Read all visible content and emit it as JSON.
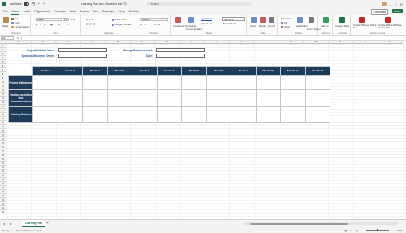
{
  "titlebar": {
    "autosave_label": "AutoSave",
    "doc_title": "Learning Plan.xlsx • Saved to this PC",
    "search_placeholder": "Search",
    "window_controls": [
      "–",
      "□",
      "✕"
    ]
  },
  "tabs": [
    "File",
    "Home",
    "Insert",
    "Page Layout",
    "Formulas",
    "Data",
    "Review",
    "View",
    "Developer",
    "Help",
    "Acrobat"
  ],
  "active_tab": "Home",
  "tab_buttons": {
    "comments": "Comments",
    "share": "Share"
  },
  "ribbon": {
    "clipboard": {
      "paste": "Paste",
      "cut": "Cut",
      "copy": "Copy",
      "format_painter": "Format Painter",
      "label": "Clipboard"
    },
    "font": {
      "font_name": "Calibri",
      "font_size": "11",
      "label": "Font"
    },
    "alignment": {
      "wrap_text": "Wrap Text",
      "merge_center": "Merge & Center",
      "label": "Alignment"
    },
    "number": {
      "format": "General",
      "label": "Number"
    },
    "styles": {
      "conditional": "Conditional Formatting",
      "format_table": "Format as Table",
      "hyperlink": "Hyperlink 2",
      "normal2": "Normal 2",
      "normal23": "Normal 2 2",
      "normal222": "Normal 2 2 2",
      "label": "Styles"
    },
    "cells": {
      "insert": "Insert",
      "delete": "Delete",
      "format": "Format",
      "label": "Cells"
    },
    "editing": {
      "autosum": "AutoSum",
      "fill": "Fill",
      "clear": "Clear",
      "sort": "Sort & Filter",
      "find": "Find & Select",
      "label": "Editing"
    },
    "addins": {
      "addins": "Add-ins",
      "label": "Add-ins"
    },
    "analysis": {
      "analyze": "Analyze Data",
      "label": "Analysis"
    },
    "acrobat": {
      "create_pdf": "Create PDF and Share link",
      "create_share": "Create PDF and Share via Outlook",
      "label": "Adobe Acrobat"
    }
  },
  "formula_bar": {
    "name_box": "A1",
    "fx": "fx",
    "formula": ""
  },
  "columns": [
    "A",
    "B",
    "C",
    "D",
    "E",
    "F",
    "G",
    "H",
    "I",
    "J",
    "K",
    "L",
    "M",
    "N",
    "O",
    "P"
  ],
  "rows": [
    "1",
    "2",
    "3",
    "4",
    "5",
    "6",
    "7",
    "8",
    "9",
    "10",
    "11",
    "12",
    "13",
    "14",
    "15",
    "16",
    "17",
    "18",
    "19",
    "20",
    "21",
    "22",
    "23",
    "24",
    "25",
    "26",
    "27",
    "28",
    "29",
    "30",
    "31",
    "32",
    "33",
    "34",
    "35",
    "36",
    "37",
    "38",
    "39",
    "40",
    "41",
    "42"
  ],
  "form": {
    "project_label": "Project/Initiative Name:",
    "sponsor_label": "Sponsors/Business Owner:",
    "change_lead_label": "Change/Business Lead:",
    "date_label": "Date:"
  },
  "table": {
    "months": [
      "Month 1",
      "Month 2",
      "Month 3",
      "Month 4",
      "Month 5",
      "Month 6",
      "Month 7",
      "Month 8",
      "Month 9",
      "Month 10",
      "Month 11",
      "Month 12"
    ],
    "rows": [
      "Project Milestones",
      "Training activities and Communications",
      "Training Modules"
    ]
  },
  "sheets": {
    "active": "Learning Plan",
    "add": "+"
  },
  "status": {
    "ready": "Ready",
    "accessibility": "Accessibility: Investigate",
    "zoom": "100%"
  }
}
